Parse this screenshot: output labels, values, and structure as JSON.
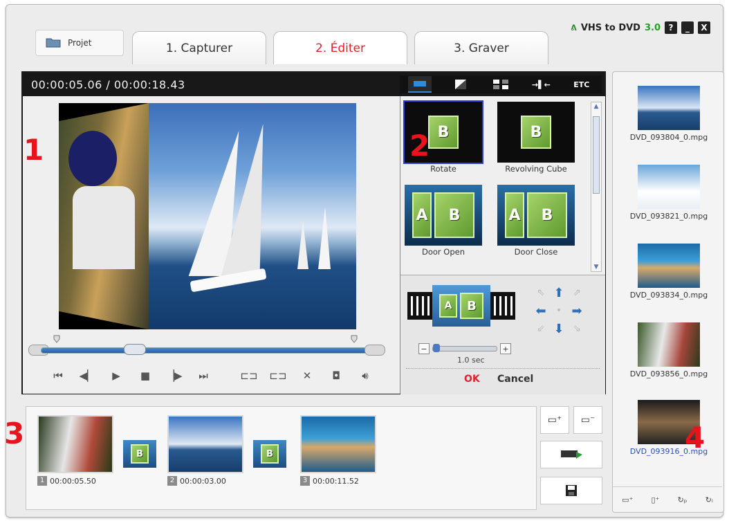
{
  "header": {
    "project_label": "Projet",
    "tabs": [
      "1. Capturer",
      "2. Éditer",
      "3. Graver"
    ],
    "active_tab": 1,
    "brand": "VHS to DVD",
    "version": "3.0",
    "window_buttons": [
      "?",
      "_",
      "X"
    ]
  },
  "preview": {
    "timecode": "00:00:05.06 / 00:00:18.43",
    "toolbar_etc": "ETC"
  },
  "effects": {
    "items": [
      "Rotate",
      "Revolving Cube",
      "Door Open",
      "Door Close"
    ],
    "selected": "Rotate",
    "duration": "1.0 sec",
    "ok": "OK",
    "cancel": "Cancel"
  },
  "library": {
    "items": [
      "DVD_093804_0.mpg",
      "DVD_093821_0.mpg",
      "DVD_093834_0.mpg",
      "DVD_093856_0.mpg",
      "DVD_093916_0.mpg"
    ]
  },
  "storyboard": {
    "clips": [
      {
        "num": "1",
        "time": "00:00:05.50"
      },
      {
        "num": "2",
        "time": "00:00:03.00"
      },
      {
        "num": "3",
        "time": "00:00:11.52"
      }
    ]
  },
  "callouts": [
    "1",
    "2",
    "3",
    "4"
  ],
  "colors": {
    "active_tab": "#e0242b",
    "ok": "#e0242b",
    "callout": "#e8141d",
    "accent_blue": "#2c8de0"
  }
}
